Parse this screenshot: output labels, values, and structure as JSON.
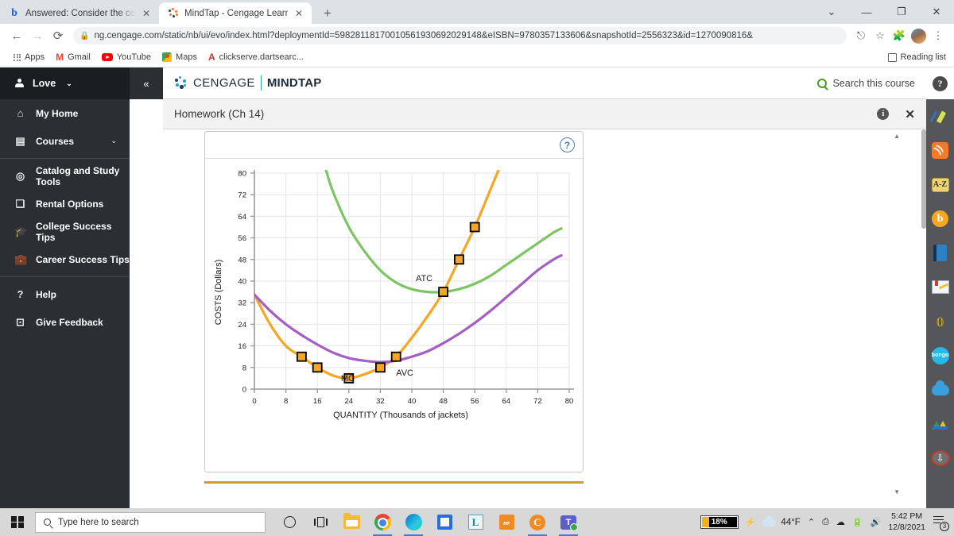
{
  "browser": {
    "tabs": [
      {
        "title": "Answered: Consider the competit",
        "favicon": "bartleby-icon",
        "active": false
      },
      {
        "title": "MindTap - Cengage Learning",
        "favicon": "cengage-icon",
        "active": true
      }
    ],
    "new_tab_label": "+",
    "window_controls": {
      "minimize_group": "⌄",
      "minimize": "—",
      "maximize": "❐",
      "close": "✕"
    },
    "nav": {
      "back": "←",
      "forward": "→",
      "reload": "C"
    },
    "url_host": "ng.cengage.com",
    "url_path": "/static/nb/ui/evo/index.html?deploymentId=5982811817001056193069202914 8&eISBN=9780357133606&snapshotId=2556323&id=1270090816&",
    "url_full": "ng.cengage.com/static/nb/ui/evo/index.html?deploymentId=59828118170010561930692029148&eISBN=9780357133606&snapshotId=2556323&id=1270090816&",
    "bookmarks": [
      {
        "label": "Apps",
        "icon": "apps-grid-icon"
      },
      {
        "label": "Gmail",
        "icon": "gmail-icon"
      },
      {
        "label": "YouTube",
        "icon": "youtube-icon"
      },
      {
        "label": "Maps",
        "icon": "maps-icon"
      },
      {
        "label": "clickserve.dartsearc...",
        "icon": "adventure-icon"
      }
    ],
    "reading_list": "Reading list"
  },
  "sidebar": {
    "user": "Love",
    "collapse_icon": "«",
    "groups": [
      {
        "items": [
          {
            "label": "My Home",
            "icon": "home-icon",
            "chevron": ""
          },
          {
            "label": "Courses",
            "icon": "book-icon",
            "chevron": "⌄"
          }
        ]
      },
      {
        "items": [
          {
            "label": "Catalog and Study Tools",
            "icon": "compass-icon",
            "chevron": ""
          },
          {
            "label": "Rental Options",
            "icon": "open-book-icon",
            "chevron": ""
          },
          {
            "label": "College Success Tips",
            "icon": "graduation-cap-icon",
            "chevron": ""
          },
          {
            "label": "Career Success Tips",
            "icon": "briefcase-icon",
            "chevron": ""
          }
        ]
      },
      {
        "items": [
          {
            "label": "Help",
            "icon": "question-circle-icon",
            "chevron": ""
          },
          {
            "label": "Give Feedback",
            "icon": "feedback-icon",
            "chevron": ""
          }
        ]
      }
    ]
  },
  "app_header": {
    "brand_cengage": "CENGAGE",
    "brand_mindtap": "MINDTAP",
    "search_label": "Search this course"
  },
  "assignment_bar": {
    "title": "Homework (Ch 14)",
    "info_icon": "info-icon",
    "close_icon": "close-icon"
  },
  "question_card": {
    "help_icon": "?"
  },
  "right_toolbar": {
    "help": "?",
    "tools": [
      {
        "name": "highlighter-pen-icon"
      },
      {
        "name": "rss-feed-icon"
      },
      {
        "name": "a-to-z-glossary-icon"
      },
      {
        "name": "brainhoney-icon"
      },
      {
        "name": "ebook-icon"
      },
      {
        "name": "notes-icon"
      },
      {
        "name": "read-aloud-icon"
      },
      {
        "name": "bongo-icon",
        "label": "bongo"
      },
      {
        "name": "onedrive-cloud-icon"
      },
      {
        "name": "google-drive-icon"
      },
      {
        "name": "anchor-download-icon"
      }
    ]
  },
  "taskbar": {
    "search_placeholder": "Type here to search",
    "apps": [
      {
        "name": "cortana-icon"
      },
      {
        "name": "task-view-icon"
      },
      {
        "name": "file-explorer-icon"
      },
      {
        "name": "chrome-icon"
      },
      {
        "name": "edge-icon"
      },
      {
        "name": "microsoft-store-icon"
      },
      {
        "name": "lockdown-browser-icon",
        "label": "L"
      },
      {
        "name": "orange-app-icon"
      },
      {
        "name": "cengage-app-icon",
        "label": "C"
      },
      {
        "name": "microsoft-teams-icon",
        "label": "T"
      }
    ],
    "battery_percent": "18%",
    "temperature": "44°F",
    "time": "5:42 PM",
    "date": "12/8/2021",
    "notification_count": "3"
  },
  "chart_data": {
    "type": "line",
    "title": "",
    "xlabel": "QUANTITY (Thousands of jackets)",
    "ylabel": "COSTS (Dollars)",
    "xlim": [
      0,
      80
    ],
    "ylim": [
      0,
      80
    ],
    "xticks": [
      0,
      8,
      16,
      24,
      32,
      40,
      48,
      56,
      64,
      72,
      80
    ],
    "yticks": [
      0,
      8,
      16,
      24,
      32,
      40,
      48,
      56,
      64,
      72,
      80
    ],
    "grid": true,
    "legend": "inline-labels",
    "colors": {
      "mc": "#F5A623",
      "atc": "#7DC563",
      "avc": "#A55EC4",
      "marker_fill": "#F5A623",
      "marker_edge": "#000000"
    },
    "series": [
      {
        "name": "MC",
        "label": "MC",
        "color": "#F5A623",
        "label_x": 22,
        "label_y": 3,
        "points": [
          {
            "x": 0,
            "y": 35
          },
          {
            "x": 4,
            "y": 24
          },
          {
            "x": 8,
            "y": 16
          },
          {
            "x": 12,
            "y": 12
          },
          {
            "x": 16,
            "y": 8
          },
          {
            "x": 20,
            "y": 5
          },
          {
            "x": 24,
            "y": 4
          },
          {
            "x": 28,
            "y": 5.5
          },
          {
            "x": 32,
            "y": 8
          },
          {
            "x": 36,
            "y": 12
          },
          {
            "x": 40,
            "y": 19
          },
          {
            "x": 44,
            "y": 27
          },
          {
            "x": 48,
            "y": 36
          },
          {
            "x": 52,
            "y": 48
          },
          {
            "x": 56,
            "y": 60
          },
          {
            "x": 60,
            "y": 74
          },
          {
            "x": 62,
            "y": 81
          }
        ],
        "markers": [
          {
            "x": 12,
            "y": 12
          },
          {
            "x": 16,
            "y": 8
          },
          {
            "x": 24,
            "y": 4
          },
          {
            "x": 32,
            "y": 8
          },
          {
            "x": 36,
            "y": 12
          },
          {
            "x": 48,
            "y": 36
          },
          {
            "x": 52,
            "y": 48
          },
          {
            "x": 56,
            "y": 60
          }
        ]
      },
      {
        "name": "ATC",
        "label": "ATC",
        "color": "#7DC563",
        "label_x": 41,
        "label_y": 40,
        "points": [
          {
            "x": 18,
            "y": 82
          },
          {
            "x": 20,
            "y": 73
          },
          {
            "x": 24,
            "y": 60
          },
          {
            "x": 28,
            "y": 51
          },
          {
            "x": 32,
            "y": 44
          },
          {
            "x": 36,
            "y": 39.5
          },
          {
            "x": 40,
            "y": 37
          },
          {
            "x": 44,
            "y": 36
          },
          {
            "x": 48,
            "y": 36
          },
          {
            "x": 52,
            "y": 37
          },
          {
            "x": 56,
            "y": 39
          },
          {
            "x": 60,
            "y": 42
          },
          {
            "x": 64,
            "y": 46
          },
          {
            "x": 68,
            "y": 50
          },
          {
            "x": 72,
            "y": 54
          },
          {
            "x": 76,
            "y": 58
          },
          {
            "x": 78,
            "y": 59.5
          }
        ],
        "markers": []
      },
      {
        "name": "AVC",
        "label": "AVC",
        "color": "#A55EC4",
        "label_x": 36,
        "label_y": 5,
        "points": [
          {
            "x": 0,
            "y": 35
          },
          {
            "x": 4,
            "y": 29
          },
          {
            "x": 8,
            "y": 24
          },
          {
            "x": 12,
            "y": 20
          },
          {
            "x": 16,
            "y": 16.5
          },
          {
            "x": 20,
            "y": 13.5
          },
          {
            "x": 24,
            "y": 11.5
          },
          {
            "x": 28,
            "y": 10.5
          },
          {
            "x": 32,
            "y": 10
          },
          {
            "x": 36,
            "y": 10.5
          },
          {
            "x": 40,
            "y": 12
          },
          {
            "x": 44,
            "y": 14
          },
          {
            "x": 48,
            "y": 17
          },
          {
            "x": 52,
            "y": 20.5
          },
          {
            "x": 56,
            "y": 24.5
          },
          {
            "x": 60,
            "y": 29
          },
          {
            "x": 64,
            "y": 34
          },
          {
            "x": 68,
            "y": 39
          },
          {
            "x": 72,
            "y": 44
          },
          {
            "x": 76,
            "y": 48
          },
          {
            "x": 78,
            "y": 49.5
          }
        ],
        "markers": []
      }
    ]
  }
}
